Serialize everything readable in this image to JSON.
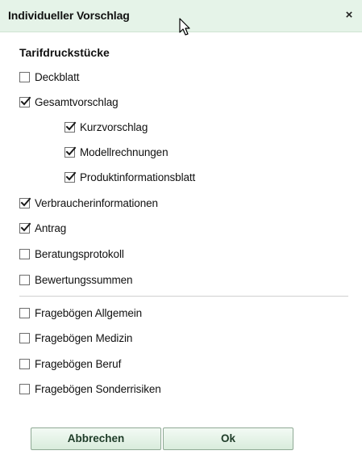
{
  "dialog": {
    "title": "Individueller Vorschlag",
    "close_symbol": "×"
  },
  "section": {
    "title": "Tarifdruckstücke"
  },
  "options": [
    {
      "label": "Deckblatt",
      "checked": false
    },
    {
      "label": "Gesamtvorschlag",
      "checked": true
    },
    {
      "label": "Kurzvorschlag",
      "checked": true
    },
    {
      "label": "Modellrechnungen",
      "checked": true
    },
    {
      "label": "Produktinformationsblatt",
      "checked": true
    },
    {
      "label": "Verbraucherinformationen",
      "checked": true
    },
    {
      "label": "Antrag",
      "checked": true
    },
    {
      "label": "Beratungsprotokoll",
      "checked": false
    },
    {
      "label": "Bewertungssummen",
      "checked": false
    },
    {
      "label": "Fragebögen Allgemein",
      "checked": false
    },
    {
      "label": "Fragebögen Medizin",
      "checked": false
    },
    {
      "label": "Fragebögen Beruf",
      "checked": false
    },
    {
      "label": "Fragebögen Sonderrisiken",
      "checked": false
    }
  ],
  "buttons": {
    "cancel": "Abbrechen",
    "ok": "Ok"
  },
  "colors": {
    "titlebar_bg": "#e5f3e8",
    "button_bg": "#d9ecdc",
    "check": "#1a1a1a"
  }
}
